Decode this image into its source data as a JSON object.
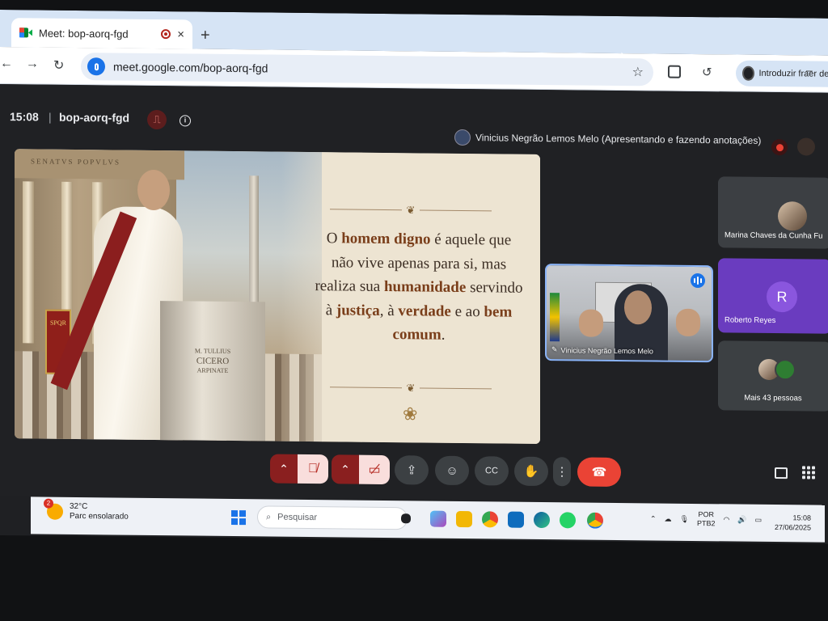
{
  "browser": {
    "tab_title": "Meet: bop-aorq-fgd",
    "new_tab_symbol": "+",
    "close_symbol": "×",
    "url": "meet.google.com/bop-aorq-fgd",
    "profile_label": "Introduzir fraer de ac"
  },
  "meet": {
    "time": "15:08",
    "separator": "|",
    "meeting_code": "bop-aorq-fgd",
    "presenter_banner": "Vinicius Negrão Lemos Melo (Apresentando e fazendo anotações)",
    "slide": {
      "frieze_text": "SENATVS POPVLVS",
      "banner_text": "SPQR",
      "podium_line1": "M. TULLIUS",
      "podium_line2": "CICERO",
      "podium_line3": "ARPINATE",
      "quote_parts": [
        {
          "text": "O ",
          "em": false
        },
        {
          "text": "homem digno",
          "em": true
        },
        {
          "text": " é aquele que não vive apenas para si, mas realiza sua ",
          "em": false
        },
        {
          "text": "humanidade",
          "em": true
        },
        {
          "text": " servindo à ",
          "em": false
        },
        {
          "text": "justiça",
          "em": true
        },
        {
          "text": ", à ",
          "em": false
        },
        {
          "text": "verdade",
          "em": true
        },
        {
          "text": " e ao ",
          "em": false
        },
        {
          "text": "bem comum",
          "em": true
        },
        {
          "text": ".",
          "em": false
        }
      ]
    },
    "presenter_tile_name": "Vinicius Negrão Lemos Melo",
    "participants": [
      {
        "name": "Marina Chaves da Cunha Fu"
      },
      {
        "name": "Roberto Reyes",
        "initial": "R"
      },
      {
        "name": "Mais 43 pessoas"
      }
    ],
    "colors": {
      "accent_blue": "#8ab4f8",
      "hangup_red": "#ea4335",
      "roberto_tile": "#6a3cbf"
    }
  },
  "taskbar": {
    "weather_badge": "2",
    "temperature": "32°C",
    "weather_desc": "Parc ensolarado",
    "search_placeholder": "Pesquisar",
    "lang_line1": "POR",
    "lang_line2": "PTB2",
    "time": "15:08",
    "date": "27/06/2025"
  }
}
